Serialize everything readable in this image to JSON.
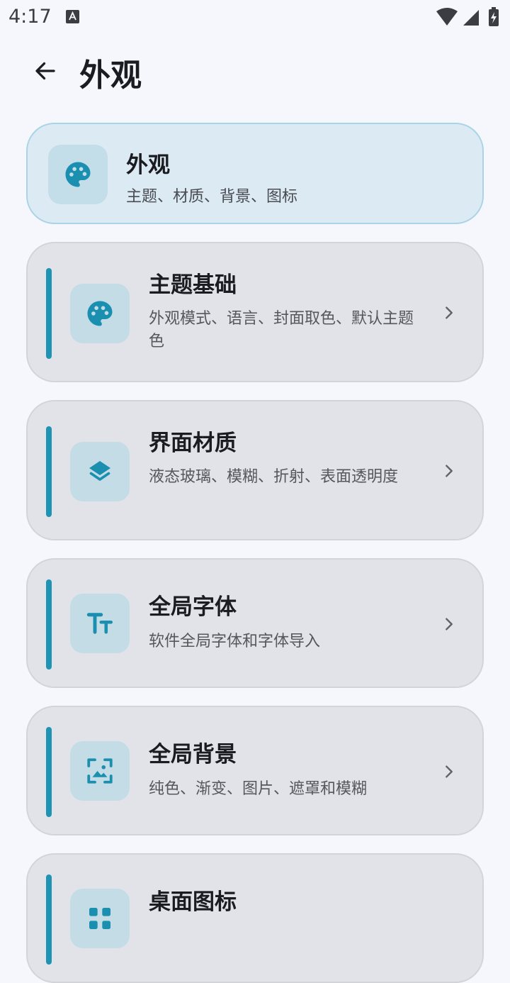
{
  "status_bar": {
    "time": "4:17",
    "notification_icon": "text-a-icon",
    "icons": [
      "wifi-icon",
      "signal-icon",
      "battery-charging-icon"
    ]
  },
  "app_bar": {
    "back_icon": "arrow-back-icon",
    "title": "外观"
  },
  "header_card": {
    "icon": "palette-icon",
    "title": "外观",
    "subtitle": "主题、材质、背景、图标"
  },
  "items": [
    {
      "icon": "palette-icon",
      "title": "主题基础",
      "desc": "外观模式、语言、封面取色、默认主题色"
    },
    {
      "icon": "layers-icon",
      "title": "界面材质",
      "desc": "液态玻璃、模糊、折射、表面透明度"
    },
    {
      "icon": "text-size-icon",
      "title": "全局字体",
      "desc": "软件全局字体和字体导入"
    },
    {
      "icon": "image-frame-icon",
      "title": "全局背景",
      "desc": "纯色、渐变、图片、遮罩和模糊"
    },
    {
      "icon": "app-grid-icon",
      "title": "桌面图标",
      "desc": ""
    }
  ],
  "colors": {
    "accent": "#1e93b3",
    "background": "#f6f7fc",
    "card": "#e2e3e8",
    "header_card": "#dceaf4"
  }
}
